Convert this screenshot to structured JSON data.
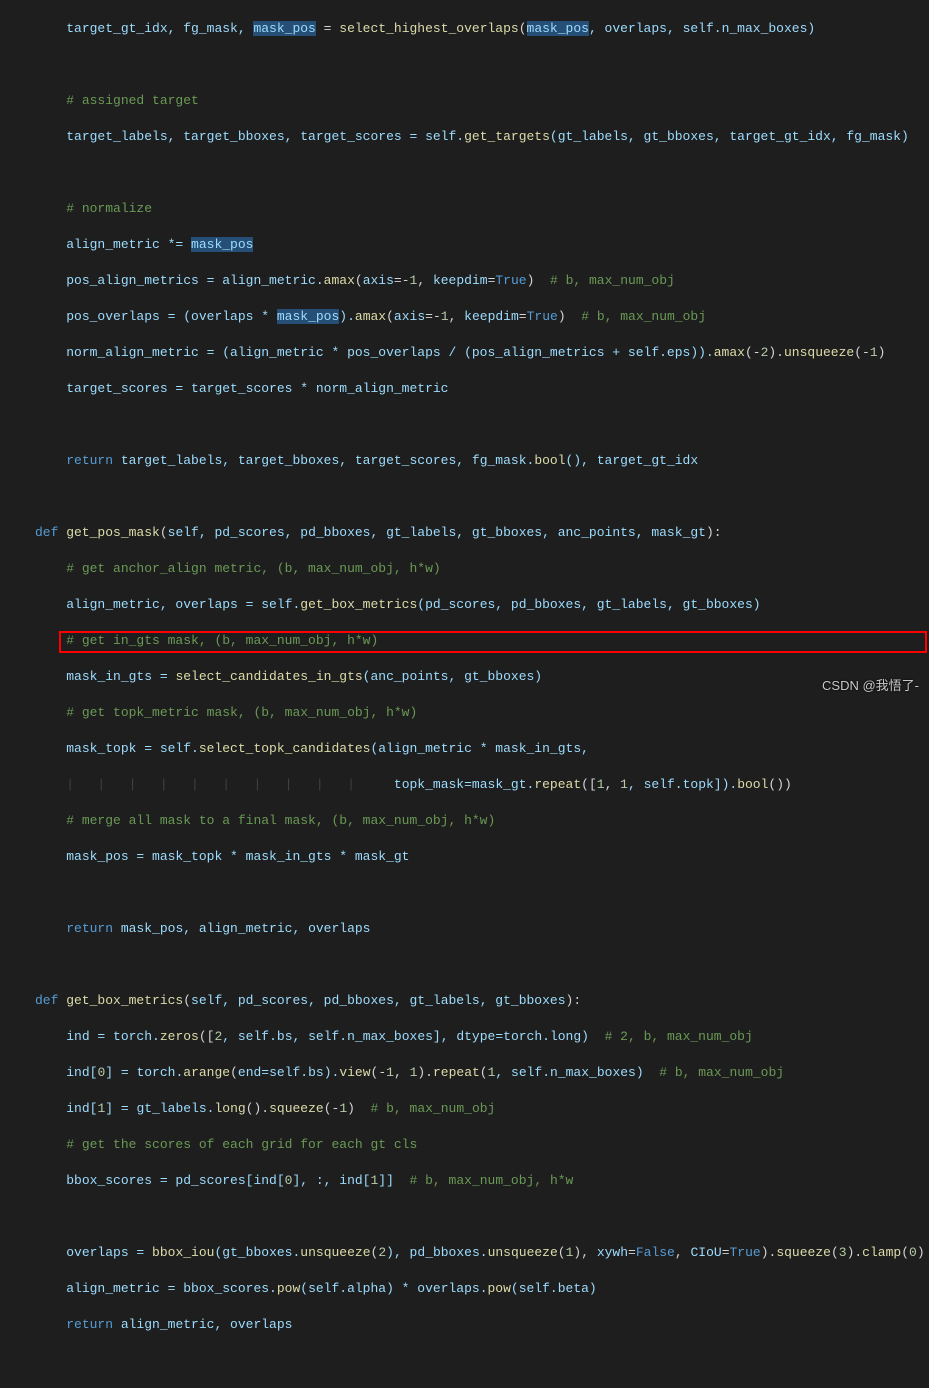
{
  "lines": {
    "l1": {
      "p1": "target_gt_idx, fg_mask, ",
      "hl1": "mask_pos",
      "p2": " = ",
      "fn": "select_highest_overlaps",
      "p3": "(",
      "hl2": "mask_pos",
      "p4": ", overlaps, self.n_max_boxes)"
    },
    "l3": {
      "c": "# assigned target"
    },
    "l4": {
      "p1": "target_labels, target_bboxes, target_scores = self.",
      "fn": "get_targets",
      "p2": "(gt_labels, gt_bboxes, target_gt_idx, fg_mask)"
    },
    "l6": {
      "c": "# normalize"
    },
    "l7": {
      "p1": "align_metric *= ",
      "hl": "mask_pos"
    },
    "l8": {
      "p1": "pos_align_metrics = align_metric.",
      "fn": "amax",
      "p2": "(",
      "kw1": "axis",
      "p3": "=-",
      "n1": "1",
      "p4": ", ",
      "kw2": "keepdim",
      "p5": "=",
      "c1": "True",
      "p6": ")  ",
      "cm": "# b, max_num_obj"
    },
    "l9": {
      "p1": "pos_overlaps = (overlaps * ",
      "hl": "mask_pos",
      "p2": ").",
      "fn": "amax",
      "p3": "(",
      "kw1": "axis",
      "p4": "=-",
      "n1": "1",
      "p5": ", ",
      "kw2": "keepdim",
      "p6": "=",
      "c1": "True",
      "p7": ")  ",
      "cm": "# b, max_num_obj"
    },
    "l10": {
      "p1": "norm_align_metric = (align_metric * pos_overlaps / (pos_align_metrics + self.eps)).",
      "fn": "amax",
      "p2": "(-",
      "n1": "2",
      "p3": ").",
      "fn2": "unsqueeze",
      "p4": "(-",
      "n2": "1",
      "p5": ")"
    },
    "l11": {
      "p1": "target_scores = target_scores * norm_align_metric"
    },
    "l13": {
      "kw": "return",
      "p1": " target_labels, target_bboxes, target_scores, fg_mask.",
      "fn": "bool",
      "p2": "(), target_gt_idx"
    },
    "l15": {
      "kw": "def",
      "fn": " get_pos_mask",
      "p1": "(",
      "args": "self, pd_scores, pd_bboxes, gt_labels, gt_bboxes, anc_points, mask_gt",
      "p2": "):"
    },
    "l16": {
      "c": "# get anchor_align metric, (b, max_num_obj, h*w)"
    },
    "l17": {
      "p1": "align_metric, overlaps = self.",
      "fn": "get_box_metrics",
      "p2": "(pd_scores, pd_bboxes, gt_labels, gt_bboxes)"
    },
    "l18": {
      "c": "# get in_gts mask, (b, max_num_obj, h*w)"
    },
    "l19": {
      "p1": "mask_in_gts = ",
      "fn": "select_candidates_in_gts",
      "p2": "(anc_points, gt_bboxes)"
    },
    "l20": {
      "c": "# get topk_metric mask, (b, max_num_obj, h*w)"
    },
    "l21": {
      "p1": "mask_topk = self.",
      "fn": "select_topk_candidates",
      "p2": "(align_metric * mask_in_gts,"
    },
    "l22": {
      "kw": "topk_mask",
      "p1": "=mask_gt.",
      "fn": "repeat",
      "p2": "([",
      "n1": "1",
      "p3": ", ",
      "n2": "1",
      "p4": ", self.topk]).",
      "fn2": "bool",
      "p5": "())"
    },
    "l23": {
      "c": "# merge all mask to a final mask, (b, max_num_obj, h*w)"
    },
    "l24": {
      "p1": "mask_pos = mask_topk * mask_in_gts * mask_gt"
    },
    "l26": {
      "kw": "return",
      "p1": " mask_pos, align_metric, overlaps"
    },
    "l28": {
      "kw": "def",
      "fn": " get_box_metrics",
      "p1": "(",
      "args": "self, pd_scores, pd_bboxes, gt_labels, gt_bboxes",
      "p2": "):"
    },
    "l29": {
      "p1": "ind = torch.",
      "fn": "zeros",
      "p2": "([",
      "n1": "2",
      "p3": ", self.bs, self.n_max_boxes], ",
      "kw1": "dtype",
      "p4": "=torch.long)  ",
      "cm": "# 2, b, max_num_obj"
    },
    "l30": {
      "p1": "ind[",
      "n1": "0",
      "p2": "] = torch.",
      "fn": "arange",
      "p3": "(",
      "kw1": "end",
      "p4": "=self.bs).",
      "fn2": "view",
      "p5": "(-",
      "n2": "1",
      "p6": ", ",
      "n3": "1",
      "p7": ").",
      "fn3": "repeat",
      "p8": "(",
      "n4": "1",
      "p9": ", self.n_max_boxes)  ",
      "cm": "# b, max_num_obj"
    },
    "l31": {
      "p1": "ind[",
      "n1": "1",
      "p2": "] = gt_labels.",
      "fn": "long",
      "p3": "().",
      "fn2": "squeeze",
      "p4": "(-",
      "n2": "1",
      "p5": ")  ",
      "cm": "# b, max_num_obj"
    },
    "l32": {
      "c": "# get the scores of each grid for each gt cls"
    },
    "l33": {
      "p1": "bbox_scores = pd_scores[ind[",
      "n1": "0",
      "p2": "], :, ind[",
      "n2": "1",
      "p3": "]]  ",
      "cm": "# b, max_num_obj, h*w"
    },
    "l35": {
      "p1": "overlaps = ",
      "fn": "bbox_iou",
      "p2": "(gt_bboxes.",
      "fn2": "unsqueeze",
      "p3": "(",
      "n1": "2",
      "p4": "), pd_bboxes.",
      "fn3": "unsqueeze",
      "p5": "(",
      "n2": "1",
      "p6": "), ",
      "kw1": "xywh",
      "p7": "=",
      "c1": "False",
      "p8": ", ",
      "kw2": "CIoU",
      "p9": "=",
      "c2": "True",
      "p10": ").",
      "fn4": "squeeze",
      "p11": "(",
      "n3": "3",
      "p12": ").",
      "fn5": "clamp",
      "p13": "(",
      "n4": "0",
      "p14": ")"
    },
    "l36": {
      "p1": "align_metric = bbox_scores.",
      "fn": "pow",
      "p2": "(self.alpha) * overlaps.",
      "fn2": "pow",
      "p3": "(self.beta)"
    },
    "l37": {
      "kw": "return",
      "p1": " align_metric, overlaps"
    }
  },
  "watermark": "CSDN @我悟了-"
}
